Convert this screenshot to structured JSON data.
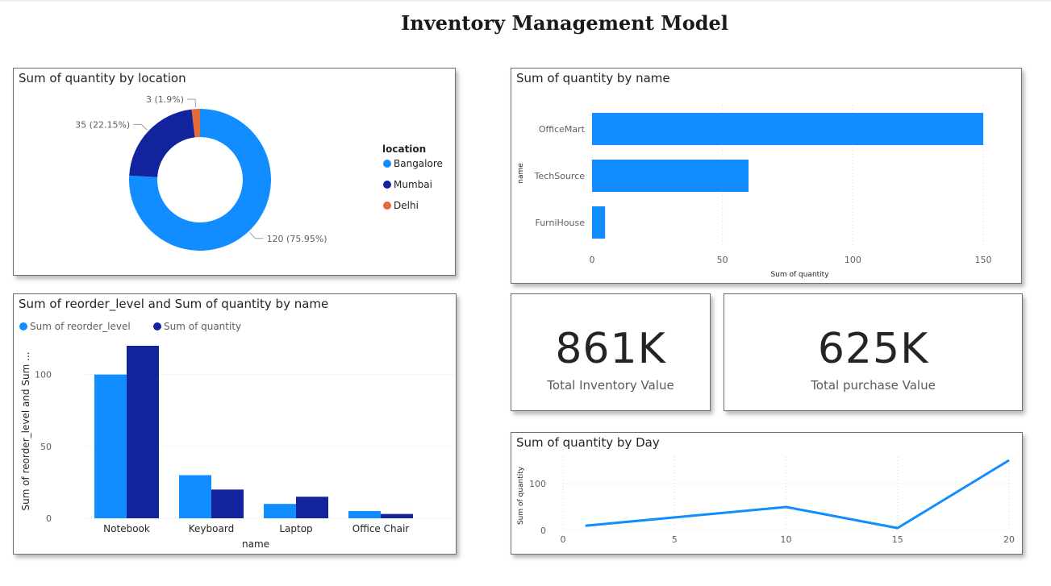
{
  "page": {
    "title": "Inventory Management Model"
  },
  "colors": {
    "light_blue": "#118DFF",
    "dark_blue": "#12239E",
    "orange": "#E66C37",
    "grid": "#d9d9d9",
    "text": "#605E5C"
  },
  "kpis": [
    {
      "value": "861K",
      "label": "Total Inventory Value"
    },
    {
      "value": "625K",
      "label": "Total purchase Value"
    }
  ],
  "chart_data": [
    {
      "id": "donut",
      "type": "pie",
      "title": "Sum of quantity by location",
      "legend_title": "location",
      "legend_position": "right",
      "slices": [
        {
          "label": "Bangalore",
          "value": 120,
          "data_label": "120 (75.95%)",
          "color": "#118DFF"
        },
        {
          "label": "Mumbai",
          "value": 35,
          "data_label": "35 (22.15%)",
          "color": "#12239E"
        },
        {
          "label": "Delhi",
          "value": 3,
          "data_label": "3 (1.9%)",
          "color": "#E66C37"
        }
      ]
    },
    {
      "id": "hbar",
      "type": "bar",
      "orientation": "horizontal",
      "title": "Sum of quantity by name",
      "categories": [
        "OfficeMart",
        "TechSource",
        "FurniHouse"
      ],
      "values": [
        150,
        60,
        5
      ],
      "xlabel": "Sum of quantity",
      "ylabel": "name",
      "xlim": [
        0,
        150
      ],
      "xticks": [
        0,
        50,
        100,
        150
      ],
      "grid": true,
      "color": "#118DFF"
    },
    {
      "id": "cbar",
      "type": "bar",
      "title": "Sum of reorder_level and Sum of quantity by name",
      "categories": [
        "Notebook",
        "Keyboard",
        "Laptop",
        "Office Chair"
      ],
      "series": [
        {
          "name": "Sum of reorder_level",
          "values": [
            100,
            30,
            10,
            5
          ],
          "color": "#118DFF"
        },
        {
          "name": "Sum of quantity",
          "values": [
            120,
            20,
            15,
            3
          ],
          "color": "#12239E"
        }
      ],
      "xlabel": "name",
      "ylabel": "Sum of reorder_level and Sum ...",
      "ylim": [
        0,
        120
      ],
      "yticks": [
        0,
        50,
        100
      ],
      "legend_position": "top-left",
      "grid": true
    },
    {
      "id": "line",
      "type": "line",
      "title": "Sum of quantity by Day",
      "x": [
        1,
        10,
        15,
        20
      ],
      "y": [
        10,
        50,
        5,
        150
      ],
      "xlabel": "",
      "ylabel": "Sum of quantity",
      "xlim": [
        0,
        20
      ],
      "ylim": [
        0,
        150
      ],
      "xticks": [
        0,
        5,
        10,
        15,
        20
      ],
      "yticks": [
        0,
        100
      ],
      "grid": true,
      "color": "#118DFF"
    }
  ]
}
